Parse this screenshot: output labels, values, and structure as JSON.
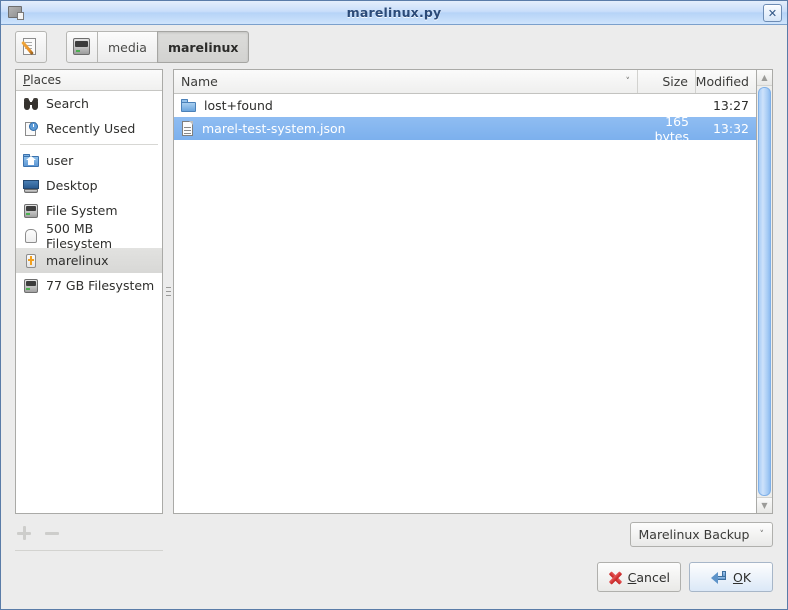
{
  "window": {
    "title": "marelinux.py",
    "icon": "window-document-icon",
    "close_label": "✕"
  },
  "toolbar": {
    "edit_button": {
      "icon": "edit-pencil-icon",
      "label": ""
    },
    "path_buttons": [
      {
        "label": "",
        "icon": "drive-icon",
        "active": false
      },
      {
        "label": "media",
        "icon": "",
        "active": false
      },
      {
        "label": "marelinux",
        "icon": "",
        "active": true
      }
    ]
  },
  "sidebar": {
    "header": "Places",
    "header_accesskey": "P",
    "items": [
      {
        "label": "Search",
        "icon": "binoculars-icon",
        "selected": false
      },
      {
        "label": "Recently Used",
        "icon": "recent-clock-icon",
        "selected": false
      },
      {
        "label": "user",
        "icon": "home-folder-icon",
        "selected": false
      },
      {
        "label": "Desktop",
        "icon": "monitor-icon",
        "selected": false
      },
      {
        "label": "File System",
        "icon": "harddrive-icon",
        "selected": false
      },
      {
        "label": "500 MB Filesystem",
        "icon": "volume-icon",
        "selected": false
      },
      {
        "label": "marelinux",
        "icon": "usb-drive-icon",
        "selected": true
      },
      {
        "label": "77 GB Filesystem",
        "icon": "harddrive-icon",
        "selected": false
      }
    ],
    "add_button": "add-place-button",
    "remove_button": "remove-place-button"
  },
  "filelist": {
    "columns": {
      "name": "Name",
      "size": "Size",
      "modified": "Modified"
    },
    "sort_indicator": "˅",
    "rows": [
      {
        "name": "lost+found",
        "icon": "folder-icon",
        "size": "",
        "modified": "13:27",
        "selected": false
      },
      {
        "name": "marel-test-system.json",
        "icon": "document-icon",
        "size": "165 bytes",
        "modified": "13:32",
        "selected": true
      }
    ]
  },
  "scrollbar": {
    "up_arrow": "▲",
    "down_arrow": "▼"
  },
  "footer": {
    "filter": {
      "value": "Marelinux Backup",
      "chevron": "˅"
    },
    "cancel": {
      "label": "Cancel",
      "accesskey": "C",
      "rest": "ancel",
      "icon": "cancel-x-icon"
    },
    "ok": {
      "label": "OK",
      "accesskey": "O",
      "rest": "K",
      "icon": "enter-arrow-icon"
    }
  },
  "colors": {
    "titlebar_text": "#2b4a78",
    "selection_blue": "#7cb0ed",
    "window_bg": "#ececec",
    "accent_orange": "#f0a020",
    "cancel_red": "#c32020"
  }
}
